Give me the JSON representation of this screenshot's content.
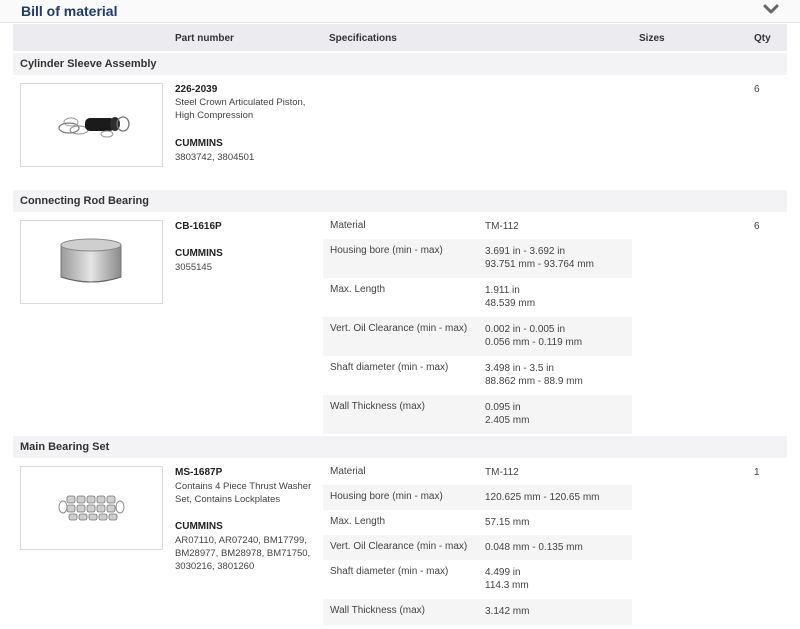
{
  "header": {
    "title": "Bill of material",
    "toggle_icon": "chevron-down-icon"
  },
  "columns": {
    "part_number": "Part number",
    "specifications": "Specifications",
    "sizes": "Sizes",
    "qty": "Qty"
  },
  "sections": [
    {
      "name": "Cylinder Sleeve Assembly",
      "part_number": "226-2039",
      "description": "Steel Crown Articulated Piston, High Compression",
      "brand": "CUMMINS",
      "refs": "3803742, 3804501",
      "qty": "6",
      "image_icon": "cylinder-sleeve-kit-image",
      "specs": []
    },
    {
      "name": "Connecting Rod Bearing",
      "part_number": "CB-1616P",
      "description": "",
      "brand": "CUMMINS",
      "refs": "3055145",
      "qty": "6",
      "image_icon": "rod-bearing-image",
      "specs": [
        {
          "label": "Material",
          "value": "TM-112",
          "value2": ""
        },
        {
          "label": "Housing bore (min - max)",
          "value": "3.691 in - 3.692 in",
          "value2": "93.751 mm - 93.764 mm"
        },
        {
          "label": "Max. Length",
          "value": "1.911 in",
          "value2": "48.539 mm"
        },
        {
          "label": "Vert. Oil Clearance (min - max)",
          "value": "0.002 in - 0.005 in",
          "value2": "0.056 mm - 0.119 mm"
        },
        {
          "label": "Shaft diameter (min - max)",
          "value": "3.498 in - 3.5 in",
          "value2": "88.862 mm - 88.9 mm"
        },
        {
          "label": "Wall Thickness (max)",
          "value": "0.095 in",
          "value2": "2.405 mm"
        }
      ]
    },
    {
      "name": "Main Bearing Set",
      "part_number": "MS-1687P",
      "description": "Contains 4 Piece Thrust Washer Set, Contains Lockplates",
      "brand": "CUMMINS",
      "refs": "AR07110, AR07240, BM17799, BM28977, BM28978, BM71750, 3030216, 3801260",
      "qty": "1",
      "image_icon": "main-bearing-set-image",
      "specs": [
        {
          "label": "Material",
          "value": "TM-112",
          "value2": ""
        },
        {
          "label": "Housing bore (min - max)",
          "value": "120.625 mm - 120.65 mm",
          "value2": ""
        },
        {
          "label": "Max. Length",
          "value": "57.15 mm",
          "value2": ""
        },
        {
          "label": "Vert. Oil Clearance (min - max)",
          "value": "0.048 mm - 0.135 mm",
          "value2": ""
        },
        {
          "label": "Shaft diameter (min - max)",
          "value": "4.499 in",
          "value2": "114.3 mm"
        },
        {
          "label": "Wall Thickness (max)",
          "value": "3.142 mm",
          "value2": ""
        }
      ]
    }
  ]
}
